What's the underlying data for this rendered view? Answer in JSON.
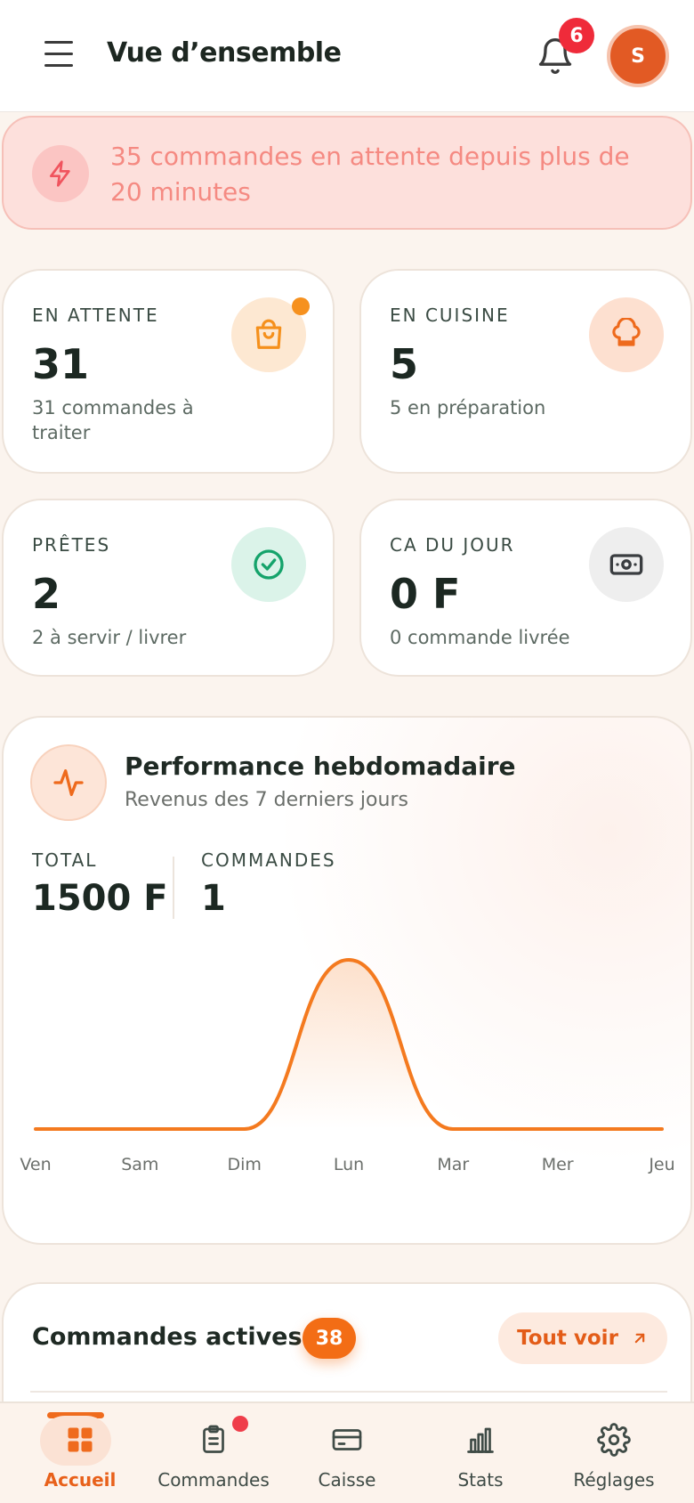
{
  "header": {
    "title": "Vue d’ensemble",
    "notification_count": "6",
    "avatar_initial": "S"
  },
  "alert": {
    "text": "35 commandes en attente depuis plus de 20 minutes"
  },
  "stats": [
    {
      "label": "EN ATTENTE",
      "value": "31",
      "sub": "31 commandes à traiter",
      "icon": "shopping-bag-icon"
    },
    {
      "label": "EN CUISINE",
      "value": "5",
      "sub": "5 en préparation",
      "icon": "chef-hat-icon"
    },
    {
      "label": "PRÊTES",
      "value": "2",
      "sub": "2 à servir / livrer",
      "icon": "check-circle-icon"
    },
    {
      "label": "CA DU JOUR",
      "value": "0 F",
      "sub": "0 commande livrée",
      "icon": "banknote-icon"
    }
  ],
  "performance": {
    "title": "Performance hebdomadaire",
    "subtitle": "Revenus des 7 derniers jours",
    "total_label": "TOTAL",
    "total_value": "1500 F",
    "orders_label": "COMMANDES",
    "orders_value": "1"
  },
  "chart_data": {
    "type": "area",
    "categories": [
      "Ven",
      "Sam",
      "Dim",
      "Lun",
      "Mar",
      "Mer",
      "Jeu"
    ],
    "values": [
      0,
      0,
      0,
      1500,
      0,
      0,
      0
    ],
    "ylim": [
      0,
      1500
    ],
    "grid": false,
    "color": "#f47a1f"
  },
  "active_orders": {
    "title": "Commandes actives",
    "count": "38",
    "see_all": "Tout voir"
  },
  "bottom_nav": [
    {
      "label": "Accueil",
      "icon": "grid-icon",
      "active": true
    },
    {
      "label": "Commandes",
      "icon": "clipboard-icon",
      "active": false
    },
    {
      "label": "Caisse",
      "icon": "card-icon",
      "active": false
    },
    {
      "label": "Stats",
      "icon": "bar-chart-icon",
      "active": false
    },
    {
      "label": "Réglages",
      "icon": "gear-icon",
      "active": false
    }
  ],
  "colors": {
    "accent": "#f36d15",
    "alert_bg": "#fde0dc",
    "alert_text": "#f58a82"
  }
}
